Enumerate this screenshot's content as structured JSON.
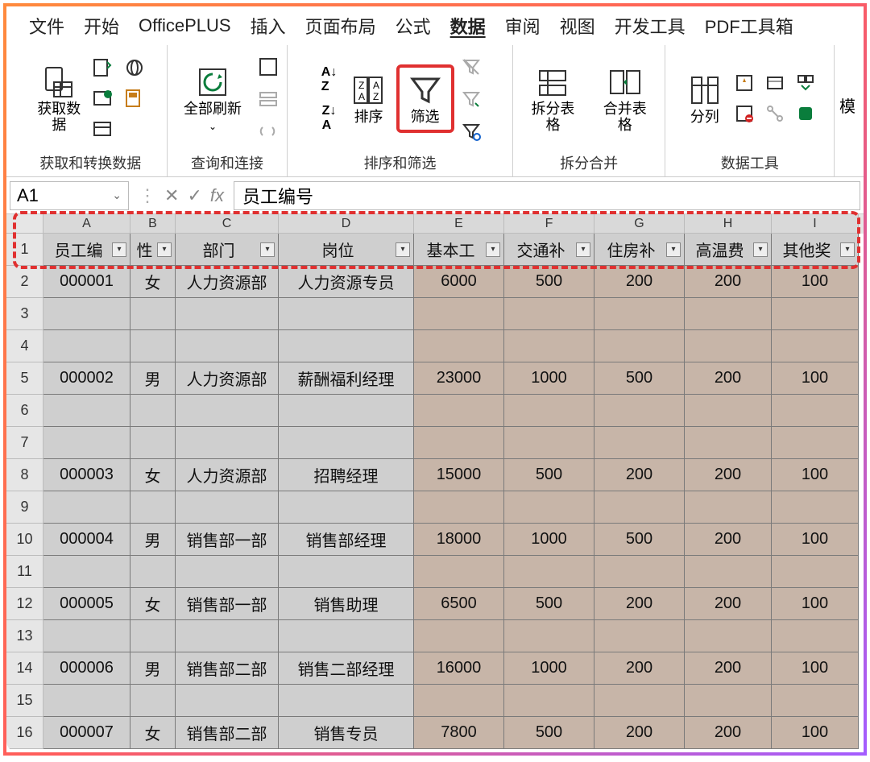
{
  "menu": {
    "items": [
      "文件",
      "开始",
      "OfficePLUS",
      "插入",
      "页面布局",
      "公式",
      "数据",
      "审阅",
      "视图",
      "开发工具",
      "PDF工具箱"
    ],
    "active_index": 6
  },
  "ribbon": {
    "groups": [
      {
        "label": "获取和转换数据",
        "get_data": "获取数\n据"
      },
      {
        "label": "查询和连接",
        "refresh": "全部刷新"
      },
      {
        "label": "排序和筛选",
        "sort": "排序",
        "filter": "筛选"
      },
      {
        "label": "拆分合并",
        "split": "拆分表格",
        "merge": "合并表格"
      },
      {
        "label": "数据工具",
        "textcol": "分列"
      }
    ],
    "trail": "模"
  },
  "formula_bar": {
    "namebox": "A1",
    "fx": "fx",
    "value": "员工编号"
  },
  "grid": {
    "cols": [
      "A",
      "B",
      "C",
      "D",
      "E",
      "F",
      "G",
      "H",
      "I"
    ],
    "header": [
      "员工编号",
      "性别",
      "部门",
      "岗位",
      "基本工资",
      "交通补贴",
      "住房补贴",
      "高温费",
      "其他奖励"
    ],
    "header_display": [
      "员工编",
      "性",
      "部门",
      "岗位",
      "基本工",
      "交通补",
      "住房补",
      "高温费",
      "其他奖"
    ],
    "rows": [
      {
        "n": 1,
        "vals": null
      },
      {
        "n": 2,
        "vals": [
          "000001",
          "女",
          "人力资源部",
          "人力资源专员",
          "6000",
          "500",
          "200",
          "200",
          "100"
        ]
      },
      {
        "n": 3,
        "vals": [
          "",
          "",
          "",
          "",
          "",
          "",
          "",
          "",
          ""
        ]
      },
      {
        "n": 4,
        "vals": [
          "",
          "",
          "",
          "",
          "",
          "",
          "",
          "",
          ""
        ]
      },
      {
        "n": 5,
        "vals": [
          "000002",
          "男",
          "人力资源部",
          "薪酬福利经理",
          "23000",
          "1000",
          "500",
          "200",
          "100"
        ]
      },
      {
        "n": 6,
        "vals": [
          "",
          "",
          "",
          "",
          "",
          "",
          "",
          "",
          ""
        ]
      },
      {
        "n": 7,
        "vals": [
          "",
          "",
          "",
          "",
          "",
          "",
          "",
          "",
          ""
        ]
      },
      {
        "n": 8,
        "vals": [
          "000003",
          "女",
          "人力资源部",
          "招聘经理",
          "15000",
          "500",
          "200",
          "200",
          "100"
        ]
      },
      {
        "n": 9,
        "vals": [
          "",
          "",
          "",
          "",
          "",
          "",
          "",
          "",
          ""
        ]
      },
      {
        "n": 10,
        "vals": [
          "000004",
          "男",
          "销售部一部",
          "销售部经理",
          "18000",
          "1000",
          "500",
          "200",
          "100"
        ]
      },
      {
        "n": 11,
        "vals": [
          "",
          "",
          "",
          "",
          "",
          "",
          "",
          "",
          ""
        ]
      },
      {
        "n": 12,
        "vals": [
          "000005",
          "女",
          "销售部一部",
          "销售助理",
          "6500",
          "500",
          "200",
          "200",
          "100"
        ]
      },
      {
        "n": 13,
        "vals": [
          "",
          "",
          "",
          "",
          "",
          "",
          "",
          "",
          ""
        ]
      },
      {
        "n": 14,
        "vals": [
          "000006",
          "男",
          "销售部二部",
          "销售二部经理",
          "16000",
          "1000",
          "200",
          "200",
          "100"
        ]
      },
      {
        "n": 15,
        "vals": [
          "",
          "",
          "",
          "",
          "",
          "",
          "",
          "",
          ""
        ]
      },
      {
        "n": 16,
        "vals": [
          "000007",
          "女",
          "销售部二部",
          "销售专员",
          "7800",
          "500",
          "200",
          "200",
          "100"
        ]
      }
    ]
  }
}
